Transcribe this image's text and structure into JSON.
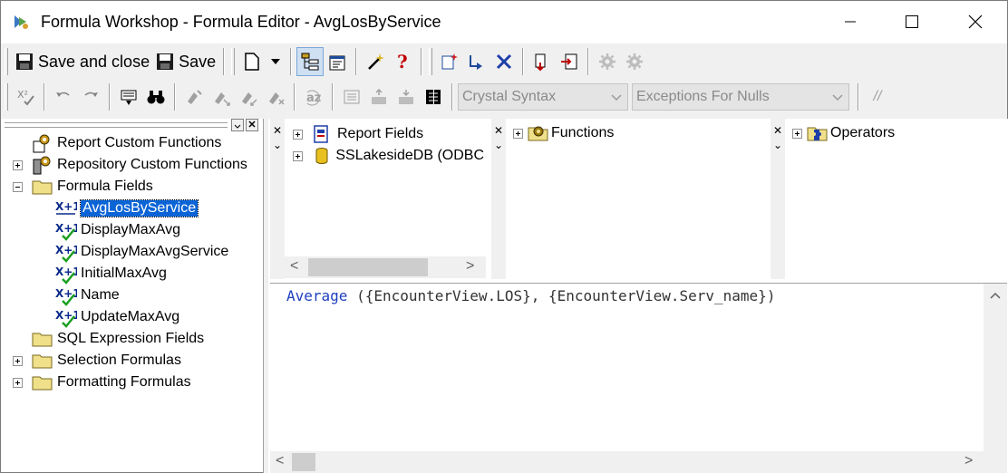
{
  "window": {
    "title": "Formula Workshop - Formula Editor - AvgLosByService",
    "minimize_glyph": "—",
    "maximize_glyph": "☐",
    "close_glyph": "✕"
  },
  "toolbar": {
    "save_and_close_label": "Save and close",
    "save_label": "Save",
    "syntax_combo": {
      "value": "Crystal Syntax"
    },
    "nulls_combo": {
      "value": "Exceptions For Nulls"
    },
    "comment_label": "//"
  },
  "tree": {
    "items": [
      {
        "label": "Report Custom Functions",
        "icon": "gear-function-icon",
        "expander": "none"
      },
      {
        "label": "Repository Custom Functions",
        "icon": "gear-repository-icon",
        "expander": "plus"
      },
      {
        "label": "Formula Fields",
        "icon": "folder-icon",
        "expander": "minus"
      },
      {
        "label": "AvgLosByService",
        "icon": "formula-icon",
        "expander": "none",
        "selected": true
      },
      {
        "label": "DisplayMaxAvg",
        "icon": "formula-check-icon",
        "expander": "none"
      },
      {
        "label": "DisplayMaxAvgService",
        "icon": "formula-check-icon",
        "expander": "none"
      },
      {
        "label": "InitialMaxAvg",
        "icon": "formula-check-icon",
        "expander": "none"
      },
      {
        "label": "Name",
        "icon": "formula-check-icon",
        "expander": "none"
      },
      {
        "label": "UpdateMaxAvg",
        "icon": "formula-check-icon",
        "expander": "none"
      },
      {
        "label": "SQL Expression Fields",
        "icon": "folder-icon",
        "expander": "none"
      },
      {
        "label": "Selection Formulas",
        "icon": "folder-icon",
        "expander": "plus"
      },
      {
        "label": "Formatting Formulas",
        "icon": "folder-icon",
        "expander": "plus"
      }
    ]
  },
  "fields_pane": {
    "items": [
      {
        "label": "Report Fields",
        "icon": "report-fields-icon"
      },
      {
        "label": "SSLakesideDB (ODBC",
        "icon": "database-icon"
      }
    ]
  },
  "functions_pane": {
    "items": [
      {
        "label": "Functions",
        "icon": "folder-gear-icon"
      }
    ]
  },
  "operators_pane": {
    "items": [
      {
        "label": "Operators",
        "icon": "folder-puzzle-icon"
      }
    ]
  },
  "editor": {
    "code_fn": "Average",
    "code_rest": " ({EncounterView.LOS}, {EncounterView.Serv_name})"
  },
  "colors": {
    "selection": "#0a64d6",
    "code_keyword": "#1f3fc0",
    "toolbar_bg": "#f0f0f0"
  }
}
